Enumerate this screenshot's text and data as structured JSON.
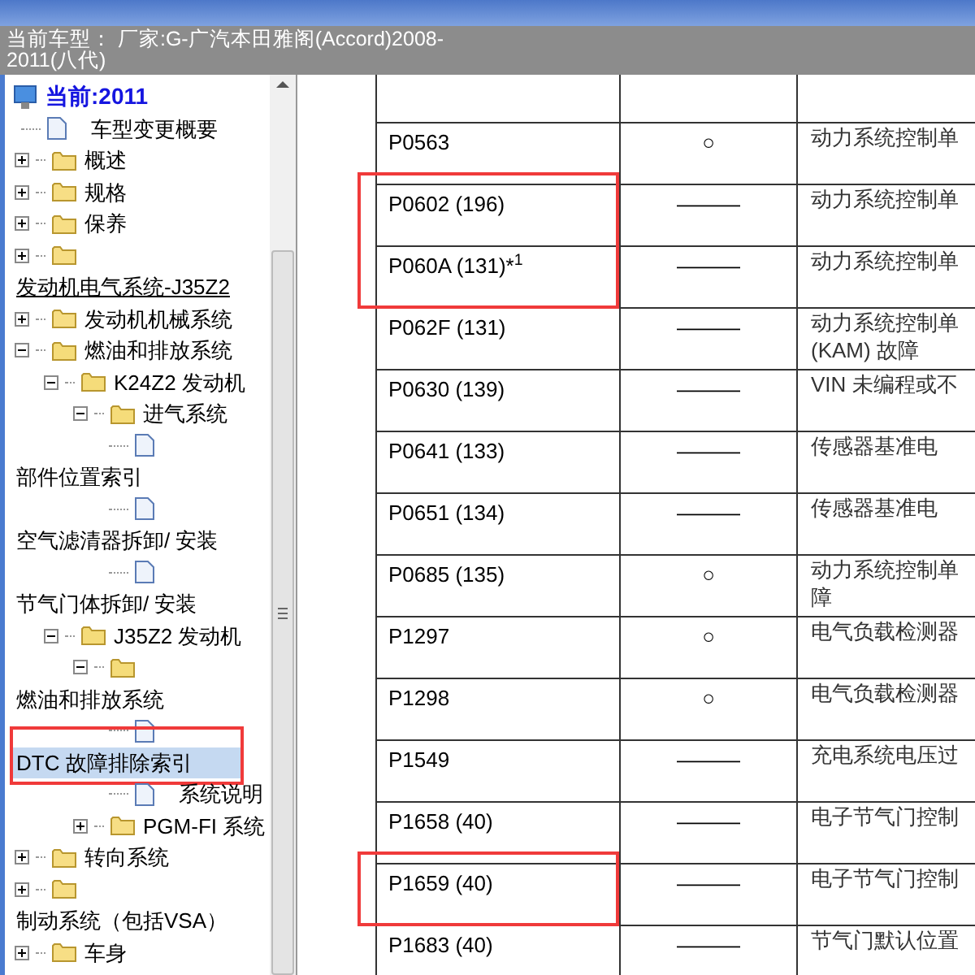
{
  "header": {
    "lines": [
      "当前车型： 厂家:G-广汽本田雅阁(Accord)2008-",
      "2011(八代)"
    ]
  },
  "tree": {
    "root": {
      "label": "当前:2011",
      "selected": false
    },
    "items": [
      {
        "kind": "doc",
        "label": "车型变更概要",
        "selected": false
      },
      {
        "kind": "folder",
        "label": "概述",
        "expanded": false,
        "selected": false
      },
      {
        "kind": "folder",
        "label": "规格",
        "expanded": false,
        "selected": false
      },
      {
        "kind": "folder",
        "label": "保养",
        "expanded": false,
        "selected": false
      },
      {
        "kind": "folder",
        "expanded": false,
        "selected": false
      },
      {
        "kind": "link",
        "label": "发动机电气系统-J35Z2",
        "selected": false
      },
      {
        "kind": "folder",
        "label": "发动机机械系统",
        "expanded": false,
        "selected": false
      },
      {
        "kind": "folder",
        "label": "燃油和排放系统",
        "expanded": true,
        "selected": false,
        "children": [
          {
            "kind": "folder",
            "label": "K24Z2 发动机",
            "expanded": true,
            "selected": false,
            "children": [
              {
                "kind": "folder",
                "label": "进气系统",
                "expanded": true,
                "selected": false,
                "children": [
                  {
                    "kind": "doc",
                    "selected": false
                  },
                  {
                    "kind": "label",
                    "label": "部件位置索引",
                    "selected": false
                  },
                  {
                    "kind": "doc",
                    "selected": false
                  },
                  {
                    "kind": "label",
                    "label": "空气滤清器拆卸/ 安装",
                    "selected": false
                  },
                  {
                    "kind": "doc",
                    "selected": false
                  },
                  {
                    "kind": "label",
                    "label": "节气门体拆卸/ 安装",
                    "selected": false
                  }
                ]
              }
            ]
          },
          {
            "kind": "folder",
            "label": "J35Z2 发动机",
            "expanded": true,
            "selected": false,
            "children": [
              {
                "kind": "folder",
                "expanded": true,
                "selected": false,
                "children": [
                  {
                    "kind": "label",
                    "label": "燃油和排放系统",
                    "selected": false
                  },
                  {
                    "kind": "doc",
                    "selected": false
                  },
                  {
                    "kind": "label",
                    "label": "DTC 故障排除索引",
                    "selected": true,
                    "annotated": true
                  },
                  {
                    "kind": "doc",
                    "label": "系统说明",
                    "selected": false
                  }
                ]
              },
              {
                "kind": "folder",
                "label": "PGM-FI 系统",
                "expanded": false,
                "selected": false
              }
            ]
          }
        ]
      },
      {
        "kind": "folder",
        "label": "转向系统",
        "expanded": false,
        "selected": false
      },
      {
        "kind": "folder",
        "expanded": false,
        "selected": false
      },
      {
        "kind": "label",
        "label": "制动系统（包括VSA）",
        "selected": false
      },
      {
        "kind": "folder",
        "label": "车身",
        "expanded": false,
        "selected": false
      }
    ]
  },
  "table": {
    "rows": [
      {
        "column_1": "P0563",
        "column_2": "○",
        "column_3": "动力系统控制单",
        "annotated": false
      },
      {
        "column_1": "P0602 (196)",
        "column_2": "———",
        "column_3": "动力系统控制单",
        "annotated": true
      },
      {
        "column_1": "P060A (131)*$^{1}$",
        "column_2": "———",
        "column_3": "动力系统控制单",
        "annotated": true
      },
      {
        "column_1": "P062F (131)",
        "column_2": "———",
        "column_3": [
          "动力系统控制单",
          "(KAM) 故障"
        ],
        "annotated": false
      },
      {
        "column_1": "P0630 (139)",
        "column_2": "———",
        "column_3": "VIN 未编程或不",
        "annotated": false
      },
      {
        "column_1": "P0641 (133)",
        "column_2": "———",
        "column_3": "传感器基准电",
        "annotated": false
      },
      {
        "column_1": "P0651 (134)",
        "column_2": "———",
        "column_3": "传感器基准电",
        "annotated": false
      },
      {
        "column_1": "P0685 (135)",
        "column_2": "○",
        "column_3": [
          "动力系统控制单",
          "障"
        ],
        "annotated": false
      },
      {
        "column_1": "P1297",
        "column_2": "○",
        "column_3": "电气负载检测器",
        "annotated": false
      },
      {
        "column_1": "P1298",
        "column_2": "○",
        "column_3": "电气负载检测器",
        "annotated": false
      },
      {
        "column_1": "P1549",
        "column_2": "———",
        "column_3": "充电系统电压过",
        "annotated": false
      },
      {
        "column_1": "P1658 (40)",
        "column_2": "———",
        "column_3": "电子节气门控制",
        "annotated": false
      },
      {
        "column_1": "P1659 (40)",
        "column_2": "———",
        "column_3": "电子节气门控制",
        "annotated": true
      },
      {
        "column_1": "P1683 (40)",
        "column_2": "———",
        "column_3": "节气门默认位置",
        "annotated": false
      }
    ]
  }
}
